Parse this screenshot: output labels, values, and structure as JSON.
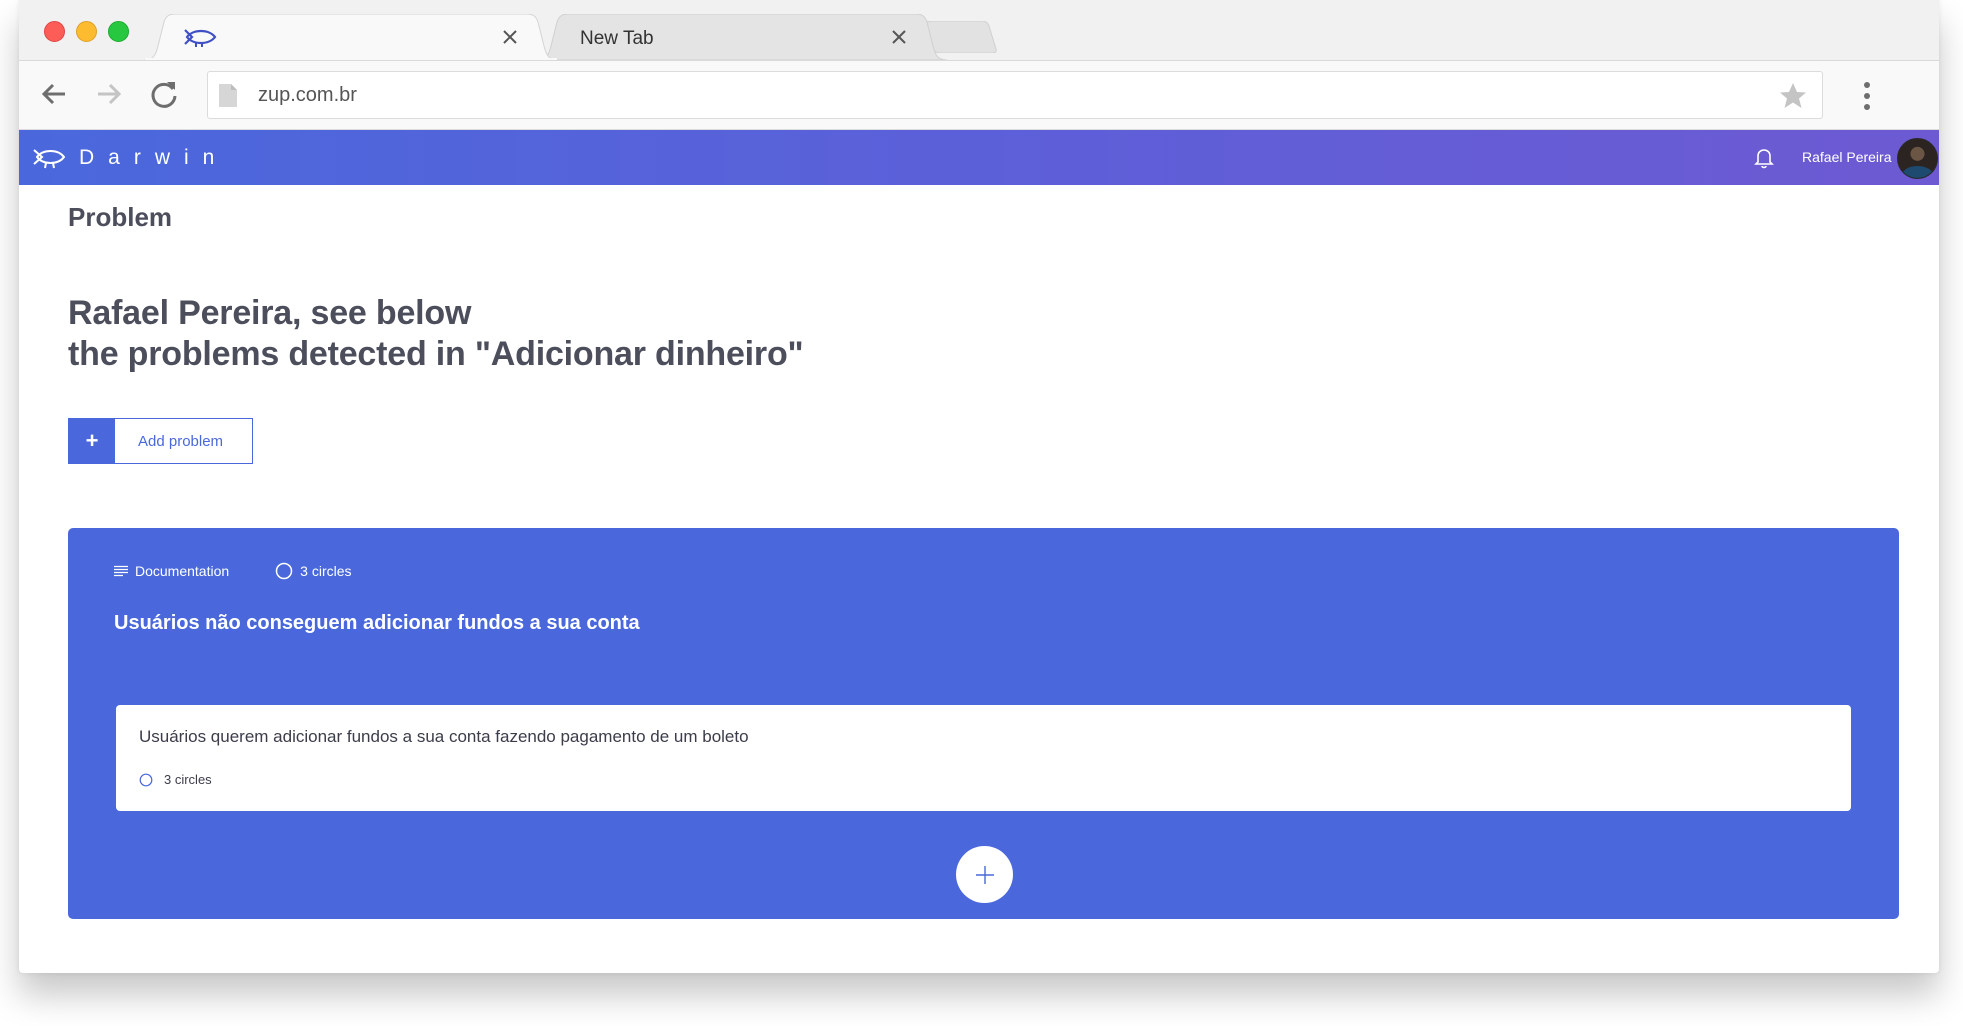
{
  "browser": {
    "tabs": [
      {
        "title": "",
        "icon": "darwin-eye-icon",
        "active": true
      },
      {
        "title": "New Tab",
        "active": false
      }
    ],
    "url": "zup.com.br"
  },
  "app": {
    "logo_text": "Darwin",
    "user_name": "Rafael Pereira"
  },
  "page": {
    "title": "Problem",
    "greeting_line1": "Rafael Pereira, see below",
    "greeting_line2": "the problems detected in \"Adicionar dinheiro\"",
    "add_button_icon": "+",
    "add_button_label": "Add problem"
  },
  "problem": {
    "documentation_label": "Documentation",
    "circles_label": "3 circles",
    "title": "Usuários não conseguem adicionar fundos a sua conta",
    "hypothesis": {
      "text": "Usuários querem adicionar fundos a sua conta fazendo pagamento de um boleto",
      "circles_label": "3 circles"
    }
  },
  "colors": {
    "accent": "#4a68dc",
    "header_gradient_end": "#6d5ad2",
    "text_dark": "#4c4e5c"
  }
}
